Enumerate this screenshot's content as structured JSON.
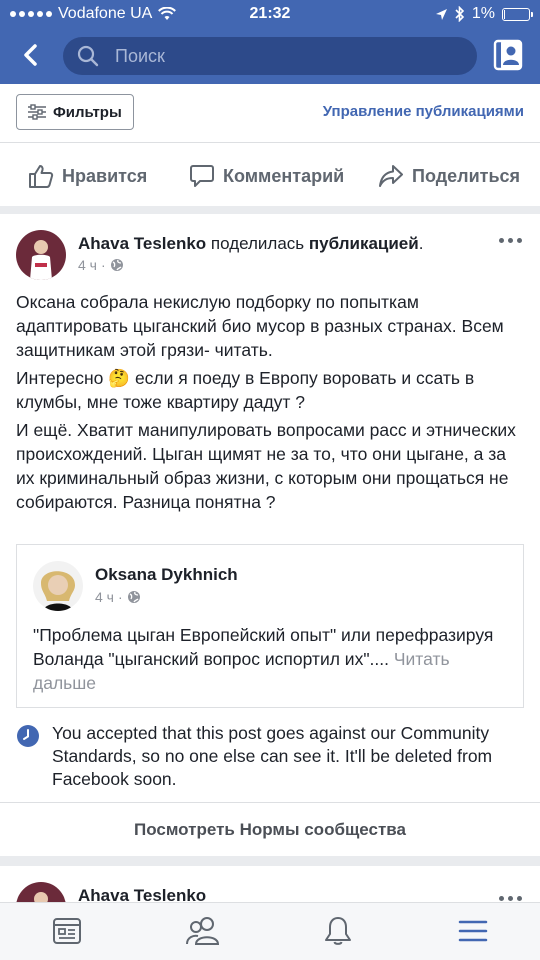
{
  "status_bar": {
    "carrier": "Vodafone UA",
    "time": "21:32",
    "battery": "1%"
  },
  "header": {
    "search_placeholder": "Поиск"
  },
  "filters": {
    "filter_label": "Фильтры",
    "manage_label": "Управление публикациями"
  },
  "actions": {
    "like": "Нравится",
    "comment": "Комментарий",
    "share": "Поделиться"
  },
  "post": {
    "author": "Ahava Teslenko",
    "action_text": " поделилась ",
    "action_object": "публикацией",
    "action_end": ".",
    "time": "4 ч",
    "paragraph1": "Оксана собрала некислую подборку по попыткам адаптировать цыганский био мусор в разных странах. Всем защитникам этой грязи- читать.",
    "paragraph2_before": "Интересно ",
    "emoji": "🤔",
    "paragraph2_after": " если я поеду в Европу воровать и ссать в клумбы, мне тоже квартиру дадут ?",
    "paragraph3": "И ещё. Хватит манипулировать вопросами расс и этнических происхождений. Цыган щимят не за то, что они цыгане, а за их криминальный образ жизни, с которым они прощаться не собираются. Разница понятна ?",
    "shared": {
      "author": "Oksana Dykhnich",
      "time": "4 ч",
      "text": "\"Проблема цыган Европейский опыт\" или перефразируя Воланда \"цыганский вопрос испортил их\"....",
      "read_more": " Читать дальше"
    },
    "notice": "You accepted that this post goes against our Community Standards, so no one else can see it. It'll be deleted from Facebook soon.",
    "standards_button": "Посмотреть Нормы сообщества"
  },
  "next_post": {
    "author": "Ahava Teslenko"
  },
  "colors": {
    "brand": "#4267b2",
    "link": "#4267b2",
    "tab_active": "#4267b2"
  },
  "tabbar": {
    "items": [
      "news-feed-icon",
      "friends-icon",
      "notifications-icon",
      "menu-icon"
    ],
    "active": "menu-icon"
  }
}
